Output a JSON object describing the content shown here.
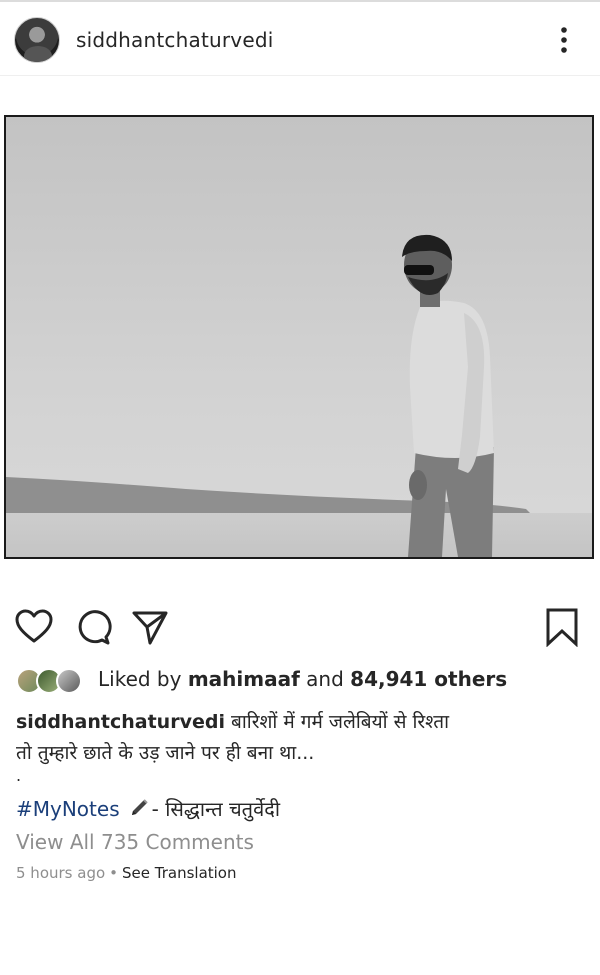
{
  "post": {
    "username": "siddhantchaturvedi",
    "photo": {
      "icon": "beach-photo-man-sunglasses"
    },
    "likes": {
      "prefix": "Liked by",
      "liker": "mahimaaf",
      "middle": "and",
      "count": "84,941 others"
    },
    "caption": {
      "username": "siddhantchaturvedi",
      "line1": "बारिशों में गर्म जलेबियों से रिश्ता",
      "line2": "तो तुम्हारे छाते के उड़ जाने पर ही बना था...",
      "dot": ".",
      "hashtag": "#MyNotes",
      "signature": "- सिद्धान्त चतुर्वेदी"
    },
    "comments": {
      "view_all": "View All 735 Comments"
    },
    "meta": {
      "time": "5 hours ago",
      "separator": "•",
      "translate": "See Translation"
    }
  },
  "icons": {
    "more": "more-vertical-icon",
    "like": "heart-icon",
    "comment": "comment-icon",
    "share": "send-icon",
    "save": "bookmark-icon",
    "pencil": "pencil-icon"
  },
  "colors": {
    "text": "#262626",
    "secondary": "#8e8e8e",
    "hashtag": "#1b3f7a"
  }
}
